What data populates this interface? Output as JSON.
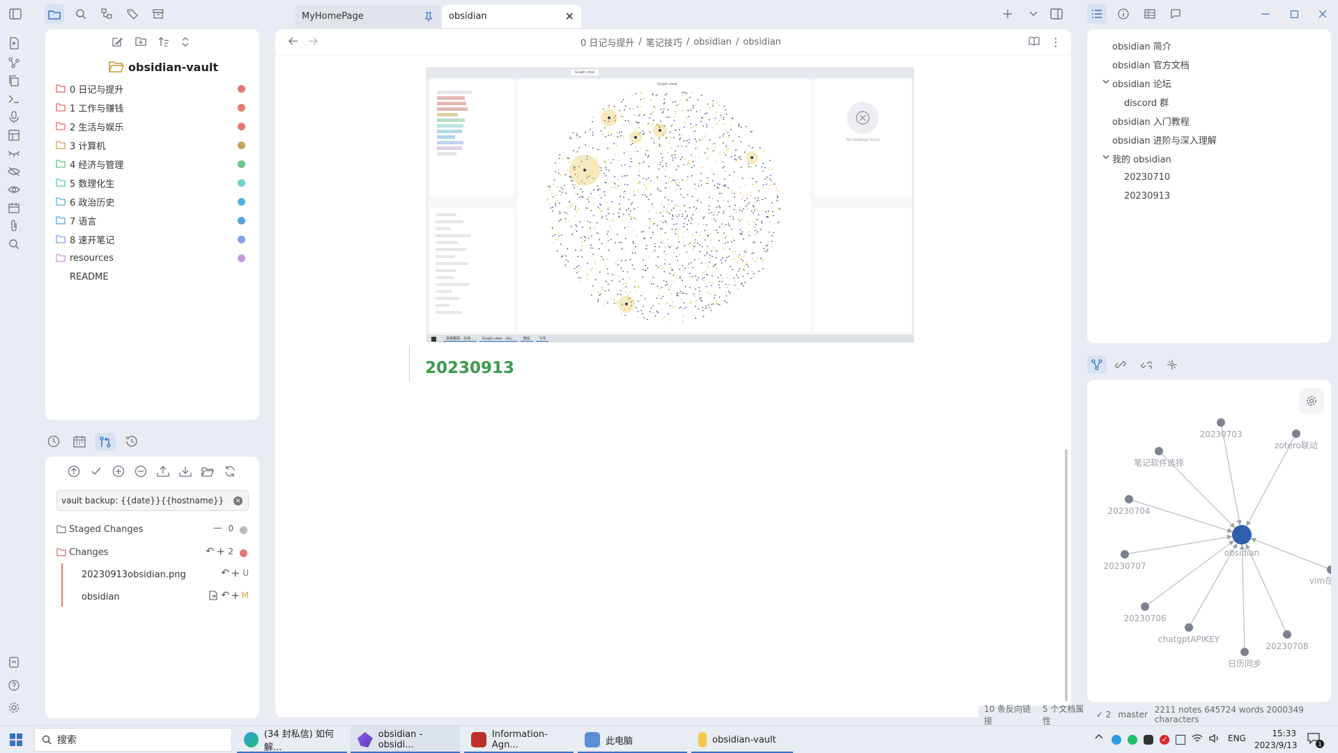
{
  "tabs": [
    {
      "label": "MyHomePage"
    },
    {
      "label": "obsidian"
    }
  ],
  "explorer": {
    "vault_name": "obsidian-vault",
    "folders": [
      {
        "label": "0 日记与提升",
        "color": "#e47a6f",
        "folder_color": "#e06b6b"
      },
      {
        "label": "1 工作与赚钱",
        "color": "#e47a6f",
        "folder_color": "#e06b6b"
      },
      {
        "label": "2 生活与娱乐",
        "color": "#e47a6f",
        "folder_color": "#e06b6b"
      },
      {
        "label": "3 计算机",
        "color": "#c9a45c",
        "folder_color": "#c9a45c"
      },
      {
        "label": "4 经济与管理",
        "color": "#6bc28a",
        "folder_color": "#6bc28a"
      },
      {
        "label": "5 数理化生",
        "color": "#6fd1c9",
        "folder_color": "#5cc4be"
      },
      {
        "label": "6 政治历史",
        "color": "#55b0d9",
        "folder_color": "#55b0d9"
      },
      {
        "label": "7 语言",
        "color": "#5aa5dc",
        "folder_color": "#5aa5dc"
      },
      {
        "label": "8 速开笔记",
        "color": "#7fa2e8",
        "folder_color": "#7f9fe8"
      },
      {
        "label": "resources",
        "color": "#c79bd9",
        "folder_color": "#c79bd9"
      }
    ],
    "readme": "README"
  },
  "git": {
    "commit_message": "vault backup: {{date}}{{hostname}}",
    "staged_label": "Staged Changes",
    "staged_count": "0",
    "changes_label": "Changes",
    "changes_count": "2",
    "files": [
      {
        "name": "20230913obsidian.png",
        "status": "U"
      },
      {
        "name": "obsidian",
        "status": "M"
      }
    ]
  },
  "editor": {
    "breadcrumb": [
      "0 日记与提升",
      "笔记技巧",
      "obsidian",
      "obsidian"
    ],
    "heading": "20230913",
    "embedded_screenshot": {
      "tab_label": "Graph view",
      "graph_title": "Graph view",
      "no_headings": "No headings found",
      "taskbar_items": [
        "百度翻译 - 在线...",
        "Graph view - obs...",
        "微信",
        "飞书"
      ]
    }
  },
  "outline": {
    "items": [
      {
        "label": "obsidian 简介",
        "level": 0
      },
      {
        "label": "obsidian 官方文档",
        "level": 0
      },
      {
        "label": "obsidian 论坛",
        "level": 0,
        "expanded": true
      },
      {
        "label": "discord 群",
        "level": 1
      },
      {
        "label": "obsidian 入门教程",
        "level": 0
      },
      {
        "label": "obsidian 进阶与深入理解",
        "level": 0
      },
      {
        "label": "我的 obsidian",
        "level": 0,
        "expanded": true
      },
      {
        "label": "20230710",
        "level": 1
      },
      {
        "label": "20230913",
        "level": 1
      }
    ]
  },
  "local_graph": {
    "center": "obsidian",
    "nodes": [
      "20230703",
      "zotero联动",
      "笔记软件选择",
      "20230704",
      "20230707",
      "20230706",
      "chatgptAPIKEY",
      "日历同步",
      "20230708",
      "vim在"
    ]
  },
  "status": {
    "backlinks": "10 条反向链接",
    "properties": "5 个文档属性",
    "git_count": "2",
    "branch": "master",
    "stats": "2211 notes 645724 words 2000349 characters"
  },
  "taskbar": {
    "search_placeholder": "搜索",
    "items": [
      {
        "label": "(34 封私信) 如何解..."
      },
      {
        "label": "obsidian - obsidi..."
      },
      {
        "label": "Information-Agn..."
      },
      {
        "label": "此电脑"
      },
      {
        "label": "obsidian-vault"
      }
    ],
    "lang": "ENG",
    "time": "15:33",
    "date": "2023/9/13",
    "notification_count": "1"
  },
  "colors": {
    "accent": "#3b6fc4",
    "heading_green": "#3a9b4b",
    "graph_center": "#2f5fa8"
  }
}
